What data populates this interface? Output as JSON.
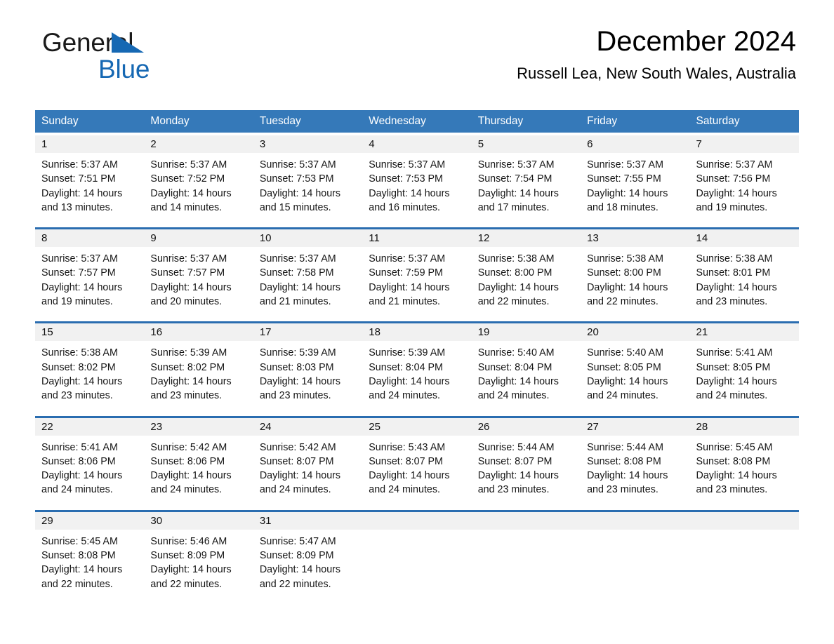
{
  "brand": {
    "line1": "General",
    "line2": "Blue",
    "accent_color": "#1668b3",
    "triangle_icon": "triangle-icon"
  },
  "header": {
    "title": "December 2024",
    "subtitle": "Russell Lea, New South Wales, Australia"
  },
  "theme": {
    "header_blue": "#3579b9",
    "row_border_blue": "#2a6db0",
    "day_band_gray": "#f1f1f1"
  },
  "weekdays": [
    "Sunday",
    "Monday",
    "Tuesday",
    "Wednesday",
    "Thursday",
    "Friday",
    "Saturday"
  ],
  "weeks": [
    [
      {
        "day": "1",
        "lines": [
          "Sunrise: 5:37 AM",
          "Sunset: 7:51 PM",
          "Daylight: 14 hours",
          "and 13 minutes."
        ]
      },
      {
        "day": "2",
        "lines": [
          "Sunrise: 5:37 AM",
          "Sunset: 7:52 PM",
          "Daylight: 14 hours",
          "and 14 minutes."
        ]
      },
      {
        "day": "3",
        "lines": [
          "Sunrise: 5:37 AM",
          "Sunset: 7:53 PM",
          "Daylight: 14 hours",
          "and 15 minutes."
        ]
      },
      {
        "day": "4",
        "lines": [
          "Sunrise: 5:37 AM",
          "Sunset: 7:53 PM",
          "Daylight: 14 hours",
          "and 16 minutes."
        ]
      },
      {
        "day": "5",
        "lines": [
          "Sunrise: 5:37 AM",
          "Sunset: 7:54 PM",
          "Daylight: 14 hours",
          "and 17 minutes."
        ]
      },
      {
        "day": "6",
        "lines": [
          "Sunrise: 5:37 AM",
          "Sunset: 7:55 PM",
          "Daylight: 14 hours",
          "and 18 minutes."
        ]
      },
      {
        "day": "7",
        "lines": [
          "Sunrise: 5:37 AM",
          "Sunset: 7:56 PM",
          "Daylight: 14 hours",
          "and 19 minutes."
        ]
      }
    ],
    [
      {
        "day": "8",
        "lines": [
          "Sunrise: 5:37 AM",
          "Sunset: 7:57 PM",
          "Daylight: 14 hours",
          "and 19 minutes."
        ]
      },
      {
        "day": "9",
        "lines": [
          "Sunrise: 5:37 AM",
          "Sunset: 7:57 PM",
          "Daylight: 14 hours",
          "and 20 minutes."
        ]
      },
      {
        "day": "10",
        "lines": [
          "Sunrise: 5:37 AM",
          "Sunset: 7:58 PM",
          "Daylight: 14 hours",
          "and 21 minutes."
        ]
      },
      {
        "day": "11",
        "lines": [
          "Sunrise: 5:37 AM",
          "Sunset: 7:59 PM",
          "Daylight: 14 hours",
          "and 21 minutes."
        ]
      },
      {
        "day": "12",
        "lines": [
          "Sunrise: 5:38 AM",
          "Sunset: 8:00 PM",
          "Daylight: 14 hours",
          "and 22 minutes."
        ]
      },
      {
        "day": "13",
        "lines": [
          "Sunrise: 5:38 AM",
          "Sunset: 8:00 PM",
          "Daylight: 14 hours",
          "and 22 minutes."
        ]
      },
      {
        "day": "14",
        "lines": [
          "Sunrise: 5:38 AM",
          "Sunset: 8:01 PM",
          "Daylight: 14 hours",
          "and 23 minutes."
        ]
      }
    ],
    [
      {
        "day": "15",
        "lines": [
          "Sunrise: 5:38 AM",
          "Sunset: 8:02 PM",
          "Daylight: 14 hours",
          "and 23 minutes."
        ]
      },
      {
        "day": "16",
        "lines": [
          "Sunrise: 5:39 AM",
          "Sunset: 8:02 PM",
          "Daylight: 14 hours",
          "and 23 minutes."
        ]
      },
      {
        "day": "17",
        "lines": [
          "Sunrise: 5:39 AM",
          "Sunset: 8:03 PM",
          "Daylight: 14 hours",
          "and 23 minutes."
        ]
      },
      {
        "day": "18",
        "lines": [
          "Sunrise: 5:39 AM",
          "Sunset: 8:04 PM",
          "Daylight: 14 hours",
          "and 24 minutes."
        ]
      },
      {
        "day": "19",
        "lines": [
          "Sunrise: 5:40 AM",
          "Sunset: 8:04 PM",
          "Daylight: 14 hours",
          "and 24 minutes."
        ]
      },
      {
        "day": "20",
        "lines": [
          "Sunrise: 5:40 AM",
          "Sunset: 8:05 PM",
          "Daylight: 14 hours",
          "and 24 minutes."
        ]
      },
      {
        "day": "21",
        "lines": [
          "Sunrise: 5:41 AM",
          "Sunset: 8:05 PM",
          "Daylight: 14 hours",
          "and 24 minutes."
        ]
      }
    ],
    [
      {
        "day": "22",
        "lines": [
          "Sunrise: 5:41 AM",
          "Sunset: 8:06 PM",
          "Daylight: 14 hours",
          "and 24 minutes."
        ]
      },
      {
        "day": "23",
        "lines": [
          "Sunrise: 5:42 AM",
          "Sunset: 8:06 PM",
          "Daylight: 14 hours",
          "and 24 minutes."
        ]
      },
      {
        "day": "24",
        "lines": [
          "Sunrise: 5:42 AM",
          "Sunset: 8:07 PM",
          "Daylight: 14 hours",
          "and 24 minutes."
        ]
      },
      {
        "day": "25",
        "lines": [
          "Sunrise: 5:43 AM",
          "Sunset: 8:07 PM",
          "Daylight: 14 hours",
          "and 24 minutes."
        ]
      },
      {
        "day": "26",
        "lines": [
          "Sunrise: 5:44 AM",
          "Sunset: 8:07 PM",
          "Daylight: 14 hours",
          "and 23 minutes."
        ]
      },
      {
        "day": "27",
        "lines": [
          "Sunrise: 5:44 AM",
          "Sunset: 8:08 PM",
          "Daylight: 14 hours",
          "and 23 minutes."
        ]
      },
      {
        "day": "28",
        "lines": [
          "Sunrise: 5:45 AM",
          "Sunset: 8:08 PM",
          "Daylight: 14 hours",
          "and 23 minutes."
        ]
      }
    ],
    [
      {
        "day": "29",
        "lines": [
          "Sunrise: 5:45 AM",
          "Sunset: 8:08 PM",
          "Daylight: 14 hours",
          "and 22 minutes."
        ]
      },
      {
        "day": "30",
        "lines": [
          "Sunrise: 5:46 AM",
          "Sunset: 8:09 PM",
          "Daylight: 14 hours",
          "and 22 minutes."
        ]
      },
      {
        "day": "31",
        "lines": [
          "Sunrise: 5:47 AM",
          "Sunset: 8:09 PM",
          "Daylight: 14 hours",
          "and 22 minutes."
        ]
      },
      {
        "day": "",
        "lines": []
      },
      {
        "day": "",
        "lines": []
      },
      {
        "day": "",
        "lines": []
      },
      {
        "day": "",
        "lines": []
      }
    ]
  ]
}
